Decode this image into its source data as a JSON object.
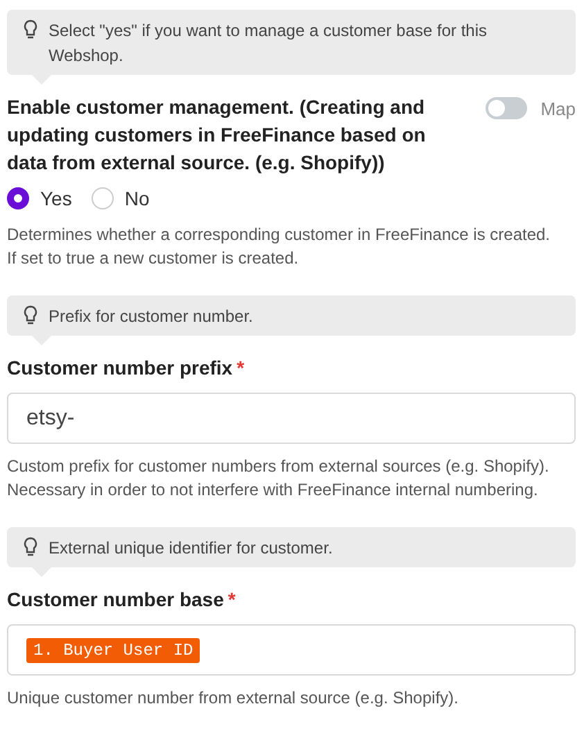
{
  "sections": [
    {
      "kind": "choice",
      "hint": "Select \"yes\" if you want to manage a customer base for this Webshop.",
      "label": "Enable customer management. (Creating and updating customers in FreeFinance based on data from external source. (e.g. Shopify))",
      "map_toggle": {
        "label": "Map",
        "on": false
      },
      "options": [
        {
          "label": "Yes",
          "selected": true
        },
        {
          "label": "No",
          "selected": false
        }
      ],
      "description": "Determines whether a corresponding customer in FreeFinance is created. If set to true a new customer is created."
    },
    {
      "kind": "text",
      "hint": "Prefix for customer number.",
      "label": "Customer number prefix",
      "required_mark": "*",
      "value": "etsy-",
      "description": "Custom prefix for customer numbers from external sources (e.g. Shopify). Necessary in order to not interfere with FreeFinance internal numbering."
    },
    {
      "kind": "token",
      "hint": "External unique identifier for customer.",
      "label": "Customer number base",
      "required_mark": "*",
      "token": "1. Buyer User ID",
      "description": "Unique customer number from external source (e.g. Shopify)."
    }
  ]
}
